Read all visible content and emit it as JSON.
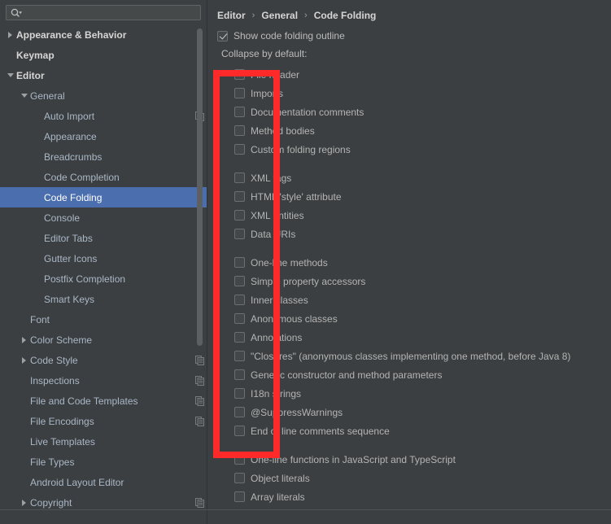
{
  "search": {
    "placeholder": "",
    "value": "",
    "icon": "search-icon",
    "dropdown_icon": "chevron-down-icon"
  },
  "sidebar": {
    "scrollbar": "vertical-scrollbar",
    "items": [
      {
        "label": "Appearance & Behavior",
        "indent": 0,
        "twisty": "collapsed",
        "bold": true,
        "selected": false,
        "copy_icon": false
      },
      {
        "label": "Keymap",
        "indent": 0,
        "twisty": "none",
        "bold": true,
        "selected": false,
        "copy_icon": false
      },
      {
        "label": "Editor",
        "indent": 0,
        "twisty": "expanded",
        "bold": true,
        "selected": false,
        "copy_icon": false
      },
      {
        "label": "General",
        "indent": 1,
        "twisty": "expanded",
        "bold": false,
        "selected": false,
        "copy_icon": false
      },
      {
        "label": "Auto Import",
        "indent": 2,
        "twisty": "none",
        "bold": false,
        "selected": false,
        "copy_icon": true
      },
      {
        "label": "Appearance",
        "indent": 2,
        "twisty": "none",
        "bold": false,
        "selected": false,
        "copy_icon": false
      },
      {
        "label": "Breadcrumbs",
        "indent": 2,
        "twisty": "none",
        "bold": false,
        "selected": false,
        "copy_icon": false
      },
      {
        "label": "Code Completion",
        "indent": 2,
        "twisty": "none",
        "bold": false,
        "selected": false,
        "copy_icon": false
      },
      {
        "label": "Code Folding",
        "indent": 2,
        "twisty": "none",
        "bold": false,
        "selected": true,
        "copy_icon": false
      },
      {
        "label": "Console",
        "indent": 2,
        "twisty": "none",
        "bold": false,
        "selected": false,
        "copy_icon": false
      },
      {
        "label": "Editor Tabs",
        "indent": 2,
        "twisty": "none",
        "bold": false,
        "selected": false,
        "copy_icon": false
      },
      {
        "label": "Gutter Icons",
        "indent": 2,
        "twisty": "none",
        "bold": false,
        "selected": false,
        "copy_icon": false
      },
      {
        "label": "Postfix Completion",
        "indent": 2,
        "twisty": "none",
        "bold": false,
        "selected": false,
        "copy_icon": false
      },
      {
        "label": "Smart Keys",
        "indent": 2,
        "twisty": "none",
        "bold": false,
        "selected": false,
        "copy_icon": false
      },
      {
        "label": "Font",
        "indent": 1,
        "twisty": "none",
        "bold": false,
        "selected": false,
        "copy_icon": false
      },
      {
        "label": "Color Scheme",
        "indent": 1,
        "twisty": "collapsed",
        "bold": false,
        "selected": false,
        "copy_icon": false
      },
      {
        "label": "Code Style",
        "indent": 1,
        "twisty": "collapsed",
        "bold": false,
        "selected": false,
        "copy_icon": true
      },
      {
        "label": "Inspections",
        "indent": 1,
        "twisty": "none",
        "bold": false,
        "selected": false,
        "copy_icon": true
      },
      {
        "label": "File and Code Templates",
        "indent": 1,
        "twisty": "none",
        "bold": false,
        "selected": false,
        "copy_icon": true
      },
      {
        "label": "File Encodings",
        "indent": 1,
        "twisty": "none",
        "bold": false,
        "selected": false,
        "copy_icon": true
      },
      {
        "label": "Live Templates",
        "indent": 1,
        "twisty": "none",
        "bold": false,
        "selected": false,
        "copy_icon": false
      },
      {
        "label": "File Types",
        "indent": 1,
        "twisty": "none",
        "bold": false,
        "selected": false,
        "copy_icon": false
      },
      {
        "label": "Android Layout Editor",
        "indent": 1,
        "twisty": "none",
        "bold": false,
        "selected": false,
        "copy_icon": false
      },
      {
        "label": "Copyright",
        "indent": 1,
        "twisty": "collapsed",
        "bold": false,
        "selected": false,
        "copy_icon": true
      }
    ]
  },
  "content": {
    "breadcrumb": [
      "Editor",
      "General",
      "Code Folding"
    ],
    "breadcrumb_separator": "›",
    "show_outline": {
      "label": "Show code folding outline",
      "checked": true
    },
    "collapse_label": "Collapse by default:",
    "options": [
      {
        "label": "File header",
        "checked": false,
        "gap": false
      },
      {
        "label": "Imports",
        "checked": false,
        "gap": false
      },
      {
        "label": "Documentation comments",
        "checked": false,
        "gap": false
      },
      {
        "label": "Method bodies",
        "checked": false,
        "gap": false
      },
      {
        "label": "Custom folding regions",
        "checked": false,
        "gap": false
      },
      {
        "label": "XML tags",
        "checked": false,
        "gap": true
      },
      {
        "label": "HTML 'style' attribute",
        "checked": false,
        "gap": false
      },
      {
        "label": "XML entities",
        "checked": false,
        "gap": false
      },
      {
        "label": "Data URIs",
        "checked": false,
        "gap": false
      },
      {
        "label": "One-line methods",
        "checked": false,
        "gap": true
      },
      {
        "label": "Simple property accessors",
        "checked": false,
        "gap": false
      },
      {
        "label": "Inner classes",
        "checked": false,
        "gap": false
      },
      {
        "label": "Anonymous classes",
        "checked": false,
        "gap": false
      },
      {
        "label": "Annotations",
        "checked": false,
        "gap": false
      },
      {
        "label": "\"Closures\" (anonymous classes implementing one method, before Java 8)",
        "checked": false,
        "gap": false
      },
      {
        "label": "Generic constructor and method parameters",
        "checked": false,
        "gap": false
      },
      {
        "label": "I18n strings",
        "checked": false,
        "gap": false
      },
      {
        "label": "@SuppressWarnings",
        "checked": false,
        "gap": false
      },
      {
        "label": "End of line comments sequence",
        "checked": false,
        "gap": false
      },
      {
        "label": "One-line functions in JavaScript and TypeScript",
        "checked": false,
        "gap": true
      },
      {
        "label": "Object literals",
        "checked": false,
        "gap": false
      },
      {
        "label": "Array literals",
        "checked": false,
        "gap": false
      }
    ]
  },
  "annotation": {
    "shape": "rectangle",
    "color": "#fe2a2a"
  },
  "colors": {
    "background": "#3c3f41",
    "selection": "#4b6eaf",
    "text": "#bbbbbb",
    "heading": "#d6d6d6",
    "annotation": "#fe2a2a"
  }
}
